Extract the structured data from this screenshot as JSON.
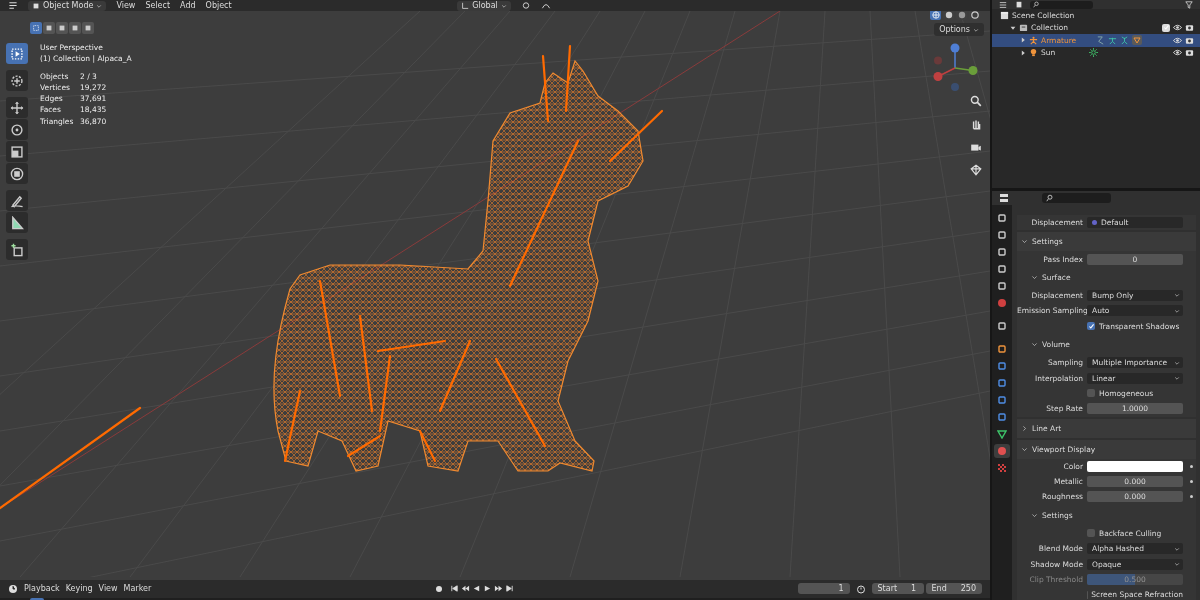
{
  "header": {
    "mode": "Object Mode",
    "menus": [
      "View",
      "Select",
      "Add",
      "Object"
    ],
    "orientation": "Global"
  },
  "select_modes": [
    {
      "selected": true
    },
    {
      "selected": false
    },
    {
      "selected": false
    },
    {
      "selected": false
    },
    {
      "selected": false
    }
  ],
  "shading_modes": [
    {
      "selected": true
    },
    {
      "selected": false
    },
    {
      "selected": false
    },
    {
      "selected": false
    }
  ],
  "options_button": "Options",
  "overlay": {
    "view": "User Perspective",
    "collection": "(1) Collection | Alpaca_A",
    "stats": [
      {
        "label": "Objects",
        "value": "2 / 3"
      },
      {
        "label": "Vertices",
        "value": "19,272"
      },
      {
        "label": "Edges",
        "value": "37,691"
      },
      {
        "label": "Faces",
        "value": "18,435"
      },
      {
        "label": "Triangles",
        "value": "36,870"
      }
    ]
  },
  "tools": [
    {
      "selected": true
    },
    {
      "selected": false
    },
    {
      "selected": false
    },
    {
      "selected": false
    },
    {
      "selected": false
    },
    {
      "selected": false
    },
    {
      "selected": false
    },
    {
      "selected": false
    },
    {
      "selected": false
    }
  ],
  "outliner": {
    "tree": [
      {
        "label": "Scene Collection",
        "children": [
          {
            "label": "Collection",
            "expanded": true,
            "checked": true,
            "children": [
              {
                "label": "Armature",
                "selected": true,
                "expanded": false
              },
              {
                "label": "Sun",
                "selected": false,
                "expanded": false
              }
            ]
          }
        ]
      }
    ]
  },
  "properties": {
    "tabs": [
      {
        "selected": false
      },
      {
        "selected": false
      },
      {
        "selected": false
      },
      {
        "selected": false
      },
      {
        "selected": false
      },
      {
        "selected": false
      },
      {
        "selected": false
      },
      {
        "selected": false
      },
      {
        "selected": false
      },
      {
        "selected": false
      },
      {
        "selected": false
      },
      {
        "selected": false
      },
      {
        "selected": false
      },
      {
        "selected": true
      },
      {
        "selected": false
      }
    ],
    "rows": [
      {
        "kind": "socket",
        "label": "Displacement",
        "value": "Default"
      },
      {
        "kind": "section",
        "label": "Settings",
        "expanded": true,
        "children": [
          {
            "kind": "number",
            "label": "Pass Index",
            "value": "0"
          },
          {
            "kind": "section",
            "label": "Surface",
            "expanded": true,
            "children": [
              {
                "kind": "dropdown",
                "label": "Displacement",
                "value": "Bump Only"
              },
              {
                "kind": "dropdown",
                "label": "Emission Sampling",
                "value": "Auto"
              },
              {
                "kind": "checkbox",
                "label": "Transparent Shadows",
                "checked": true
              }
            ]
          },
          {
            "kind": "section",
            "label": "Volume",
            "expanded": true,
            "children": [
              {
                "kind": "dropdown",
                "label": "Sampling",
                "value": "Multiple Importance"
              },
              {
                "kind": "dropdown",
                "label": "Interpolation",
                "value": "Linear"
              },
              {
                "kind": "checkbox",
                "label": "Homogeneous",
                "checked": false
              },
              {
                "kind": "number",
                "label": "Step Rate",
                "value": "1.0000"
              }
            ]
          }
        ]
      },
      {
        "kind": "section",
        "label": "Line Art",
        "expanded": false
      },
      {
        "kind": "section",
        "label": "Viewport Display",
        "expanded": true,
        "children": [
          {
            "kind": "color",
            "label": "Color",
            "color": "#ffffff",
            "animatable": true
          },
          {
            "kind": "number",
            "label": "Metallic",
            "value": "0.000",
            "animatable": true
          },
          {
            "kind": "number",
            "label": "Roughness",
            "value": "0.000",
            "animatable": true
          },
          {
            "kind": "section",
            "label": "Settings",
            "expanded": true,
            "children": [
              {
                "kind": "checkbox",
                "label": "Backface Culling",
                "checked": false
              },
              {
                "kind": "dropdown",
                "label": "Blend Mode",
                "value": "Alpha Hashed"
              },
              {
                "kind": "dropdown",
                "label": "Shadow Mode",
                "value": "Opaque"
              },
              {
                "kind": "slider",
                "label": "Clip Threshold",
                "value": "0.500",
                "level": 0.5,
                "disabled": true
              },
              {
                "kind": "checkbox",
                "label": "Screen Space Refraction",
                "checked": false
              }
            ]
          }
        ]
      }
    ]
  },
  "timeline": {
    "menus": [
      "Playback",
      "Keying",
      "View",
      "Marker"
    ],
    "current_frame": "1",
    "start_label": "Start",
    "start": "1",
    "end_label": "End",
    "end": "250"
  }
}
